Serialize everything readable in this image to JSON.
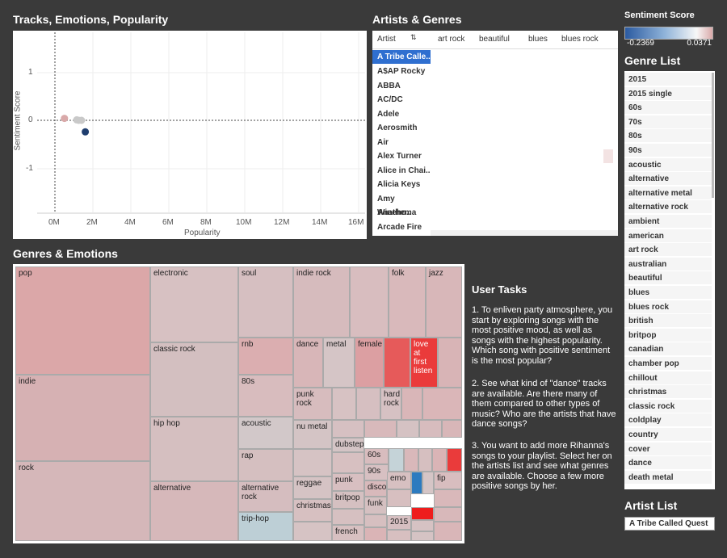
{
  "titles": {
    "tracks": "Tracks, Emotions, Popularity",
    "artists": "Artists & Genres",
    "genres_emotions": "Genres & Emotions",
    "genre_list": "Genre List",
    "artist_list": "Artist List",
    "sentiment_score": "Sentiment Score"
  },
  "legend": {
    "min": "-0.2369",
    "max": "0.0371",
    "color_low": "#2b5aa0",
    "color_mid": "#f7f7f7",
    "color_high": "#d9a9a9"
  },
  "scatter": {
    "y_label": "Sentiment Score",
    "x_label": "Popularity",
    "y_ticks": [
      "1",
      "0",
      "-1"
    ],
    "x_ticks": [
      "0M",
      "2M",
      "4M",
      "6M",
      "8M",
      "10M",
      "12M",
      "14M",
      "16M"
    ]
  },
  "chart_data": {
    "type": "scatter",
    "xlabel": "Popularity",
    "ylabel": "Sentiment Score",
    "x_ticks": [
      "0M",
      "2M",
      "4M",
      "6M",
      "8M",
      "10M",
      "12M",
      "14M",
      "16M"
    ],
    "y_ticks": [
      "1",
      "0",
      "-1"
    ],
    "points": [
      {
        "x": 500000,
        "y": 0.04,
        "color": "#d9a9a9"
      },
      {
        "x": 1150000,
        "y": 0.01,
        "color": "#c9c9c9"
      },
      {
        "x": 1250000,
        "y": 0.0,
        "color": "#c9c9c9"
      },
      {
        "x": 1400000,
        "y": 0.0,
        "color": "#c9c9c9"
      },
      {
        "x": 1600000,
        "y": -0.24,
        "color": "#1f3e6e"
      }
    ]
  },
  "artists_table": {
    "header": "Artist",
    "columns": [
      "art rock",
      "beautiful",
      "blues",
      "blues rock"
    ],
    "artists": [
      "A Tribe Calle..",
      "A$AP Rocky",
      "ABBA",
      "AC/DC",
      "Adele",
      "Aerosmith",
      "Air",
      "Alex Turner",
      "Alice in Chai..",
      "Alicia Keys",
      "Amy Wineho..",
      "Anathema",
      "Arcade Fire"
    ]
  },
  "genres": [
    "2015",
    "2015 single",
    "60s",
    "70s",
    "80s",
    "90s",
    "acoustic",
    "alternative",
    "alternative metal",
    "alternative rock",
    "ambient",
    "american",
    "art rock",
    "australian",
    "beautiful",
    "blues",
    "blues rock",
    "british",
    "britpop",
    "canadian",
    "chamber pop",
    "chillout",
    "christmas",
    "classic rock",
    "coldplay",
    "country",
    "cover",
    "dance",
    "death metal"
  ],
  "artist_list_value": "A Tribe Called Quest",
  "treemap": {
    "pop": "pop",
    "indie": "indie",
    "rock": "rock",
    "electronic": "electronic",
    "classic_rock": "classic rock",
    "hip_hop": "hip hop",
    "alternative": "alternative",
    "soul": "soul",
    "rnb": "rnb",
    "s80s": "80s",
    "acoustic": "acoustic",
    "rap": "rap",
    "alt_rock": "alternative rock",
    "trip_hop": "trip-hop",
    "indie_rock": "indie rock",
    "folk": "folk",
    "jazz": "jazz",
    "dance": "dance",
    "metal": "metal",
    "female": "female",
    "love": "love at first listen",
    "punk_rock": "punk rock",
    "hard_rock": "hard rock",
    "nu_metal": "nu metal",
    "dubstep": "dubstep",
    "s60s": "60s",
    "s90s": "90s",
    "reggae": "reggae",
    "punk": "punk",
    "disco": "disco",
    "emo": "emo",
    "fip": "fip",
    "christmas": "christmas",
    "britpop": "britpop",
    "funk": "funk",
    "s2015": "2015",
    "french": "french"
  },
  "tasks": {
    "title": "User Tasks",
    "t1": "1. To enliven party atmosphere, you start by exploring songs with the most positive mood, as well as songs with the highest popularity. Which song with positive sentiment is the most popular?",
    "t2": "2. See what kind of \"dance\" tracks are available. Are there many of them compared to other types of music? Who are the artists that have dance songs?",
    "t3": "3. You want to add more Rihanna's songs to your playlist. Select her on the artists list and see what genres are available. Choose a few more positive songs by her."
  }
}
